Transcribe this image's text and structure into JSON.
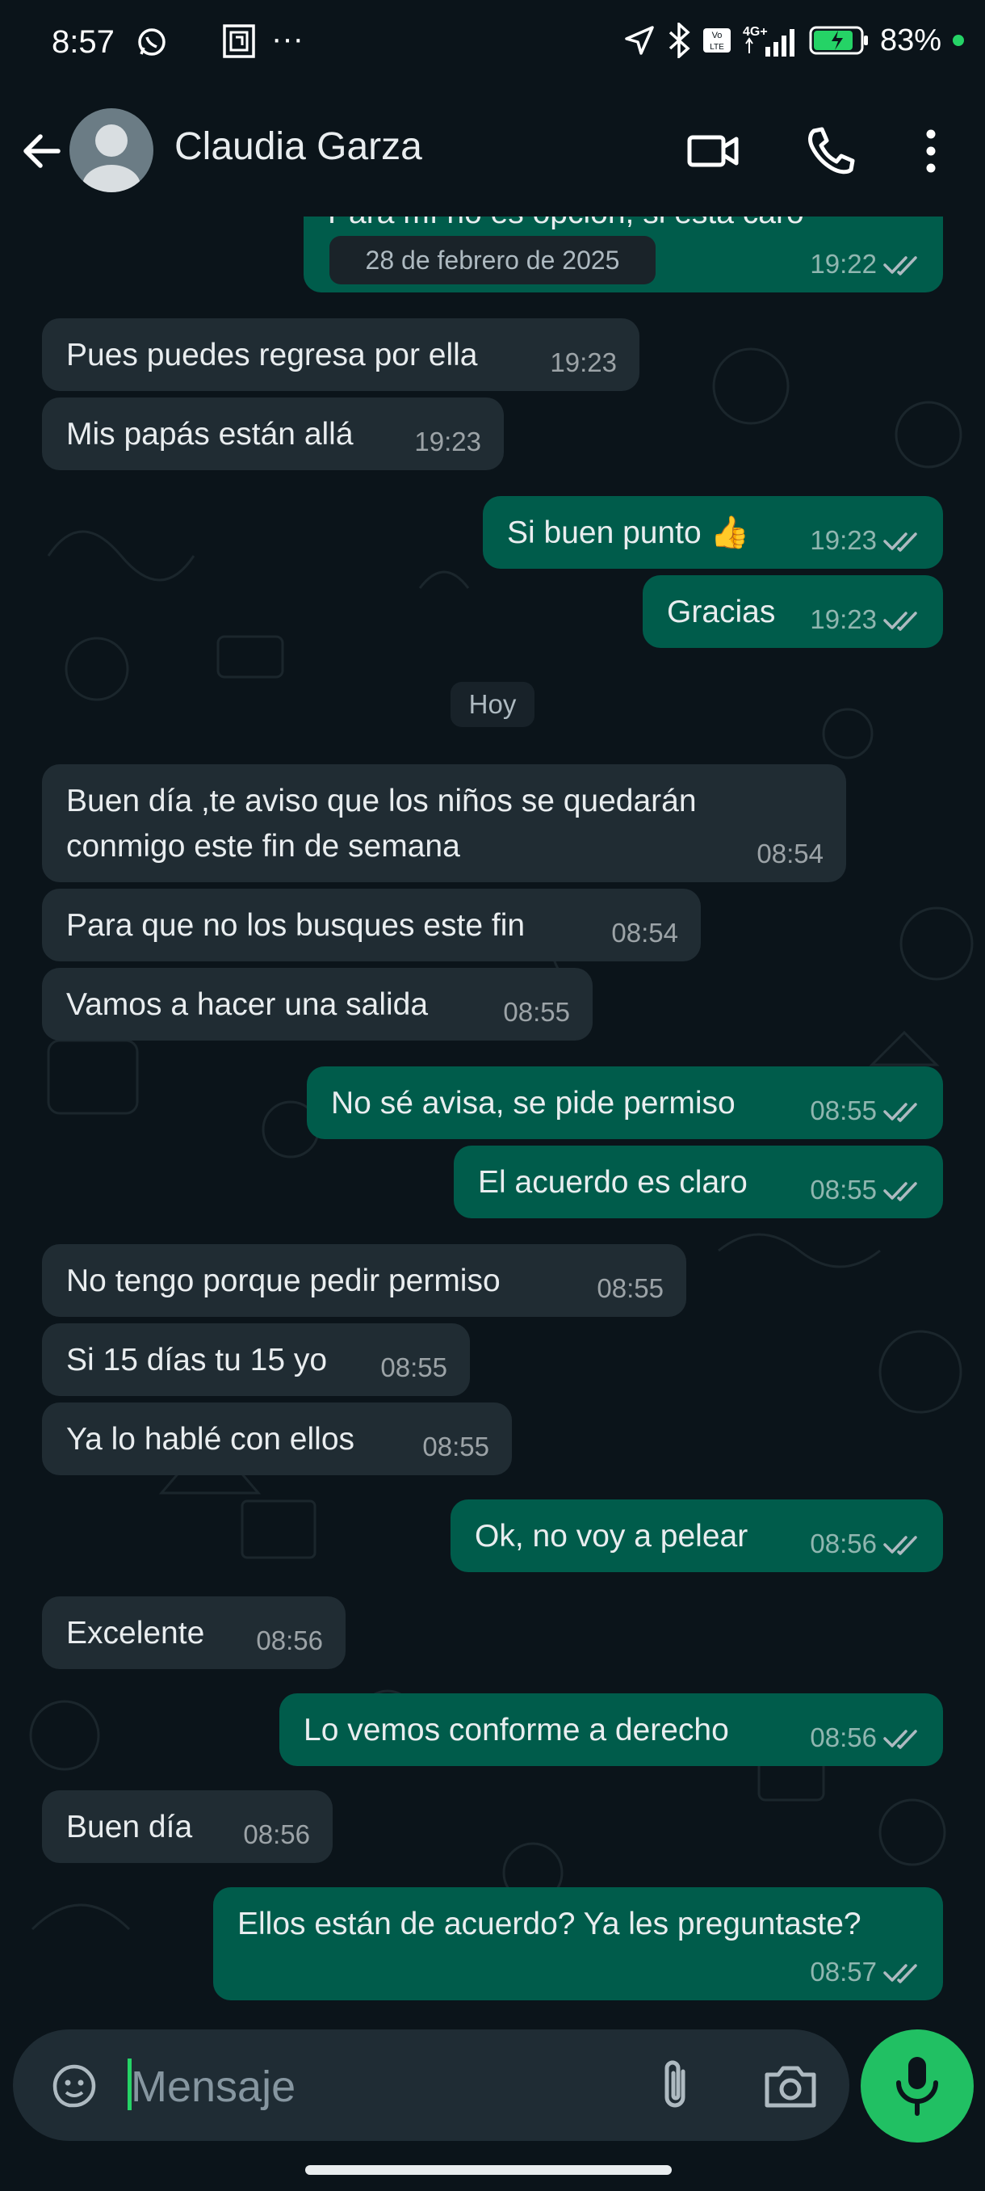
{
  "status_bar": {
    "time": "8:57",
    "battery_percent": "83%",
    "network": "4G+"
  },
  "header": {
    "contact_name": "Claudia Garza"
  },
  "chat": {
    "date_chip": "28 de febrero de 2025",
    "top_partial_text": "Para mí no es opción, si está caro",
    "top_partial_time": "19:22",
    "today_chip": "Hoy",
    "messages": [
      {
        "text": "Pues puedes regresa por ella",
        "time": "19:23",
        "dir": "in"
      },
      {
        "text": "Mis papás están allá",
        "time": "19:23",
        "dir": "in"
      },
      {
        "text": "Si buen punto 👍",
        "time": "19:23",
        "dir": "out"
      },
      {
        "text": "Gracias",
        "time": "19:23",
        "dir": "out"
      },
      {
        "text_line1": "Buen día ,te aviso que los niños se quedarán",
        "text_line2": "conmigo este fin de semana",
        "time": "08:54",
        "dir": "in"
      },
      {
        "text": "Para que no los busques este fin",
        "time": "08:54",
        "dir": "in"
      },
      {
        "text": "Vamos a hacer una salida",
        "time": "08:55",
        "dir": "in"
      },
      {
        "text": "No sé avisa, se pide permiso",
        "time": "08:55",
        "dir": "out"
      },
      {
        "text": "El acuerdo es claro",
        "time": "08:55",
        "dir": "out"
      },
      {
        "text": "No tengo porque pedir permiso",
        "time": "08:55",
        "dir": "in"
      },
      {
        "text": "Si 15 días tu 15 yo",
        "time": "08:55",
        "dir": "in"
      },
      {
        "text": "Ya lo hablé con ellos",
        "time": "08:55",
        "dir": "in"
      },
      {
        "text": "Ok, no voy a pelear",
        "time": "08:56",
        "dir": "out"
      },
      {
        "text": "Excelente",
        "time": "08:56",
        "dir": "in"
      },
      {
        "text": "Lo vemos conforme a derecho",
        "time": "08:56",
        "dir": "out"
      },
      {
        "text": "Buen día",
        "time": "08:56",
        "dir": "in"
      },
      {
        "text": "Ellos están de acuerdo? Ya les preguntaste?",
        "time": "08:57",
        "dir": "out"
      }
    ]
  },
  "composer": {
    "placeholder": "Mensaje"
  },
  "icons": [
    "back-arrow-icon",
    "video-call-icon",
    "voice-call-icon",
    "more-options-icon",
    "sticker-icon",
    "attach-icon",
    "camera-icon",
    "mic-icon"
  ],
  "colors": {
    "background": "#0b141a",
    "incoming": "#202c33",
    "outgoing": "#005c4b",
    "accent": "#21c063",
    "ticks": "#aebac1"
  }
}
